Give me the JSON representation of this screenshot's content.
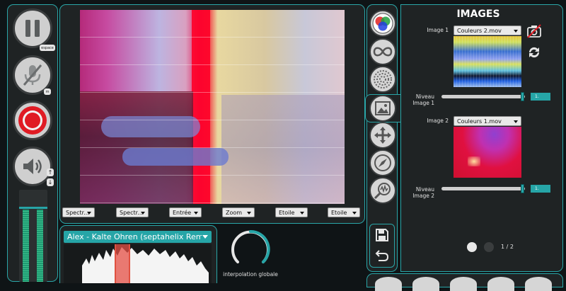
{
  "left_controls": {
    "pause_key": "espace",
    "mic_key": "m"
  },
  "spectro_dropdowns": [
    "Spectr...",
    "Spectr...",
    "Entrée",
    "Zoom",
    "Etoile",
    "Etoile"
  ],
  "audio": {
    "track_name": "Alex - Kalte Ohren (septahelix Remi..."
  },
  "knob": {
    "label": "interpolation globale"
  },
  "images_panel": {
    "title": "IMAGES",
    "image1_label": "Image 1",
    "image1_select": "Couleurs 2.mov",
    "image2_label": "Image 2",
    "image2_select": "Couleurs 1.mov",
    "niveau1_label": "Niveau\nImage 1",
    "niveau2_label": "Niveau\nImage 2",
    "niveau1_value": "1.",
    "niveau2_value": "1.",
    "niveau1_fraction": 0.95,
    "niveau2_fraction": 0.95,
    "page_indicator": "1 / 2"
  },
  "colors": {
    "accent": "#2aa6a8",
    "panel_bg": "#1f2324",
    "record_red": "#e01b24"
  },
  "icons": [
    "pause-icon",
    "mic-off-icon",
    "record-icon",
    "speaker-icon",
    "rgb-circles-icon",
    "infinity-icon",
    "dot-sphere-icon",
    "image-icon",
    "move-arrows-icon",
    "compass-icon",
    "magnifier-wave-icon",
    "save-icon",
    "undo-icon",
    "camera-off-icon",
    "refresh-icon"
  ]
}
